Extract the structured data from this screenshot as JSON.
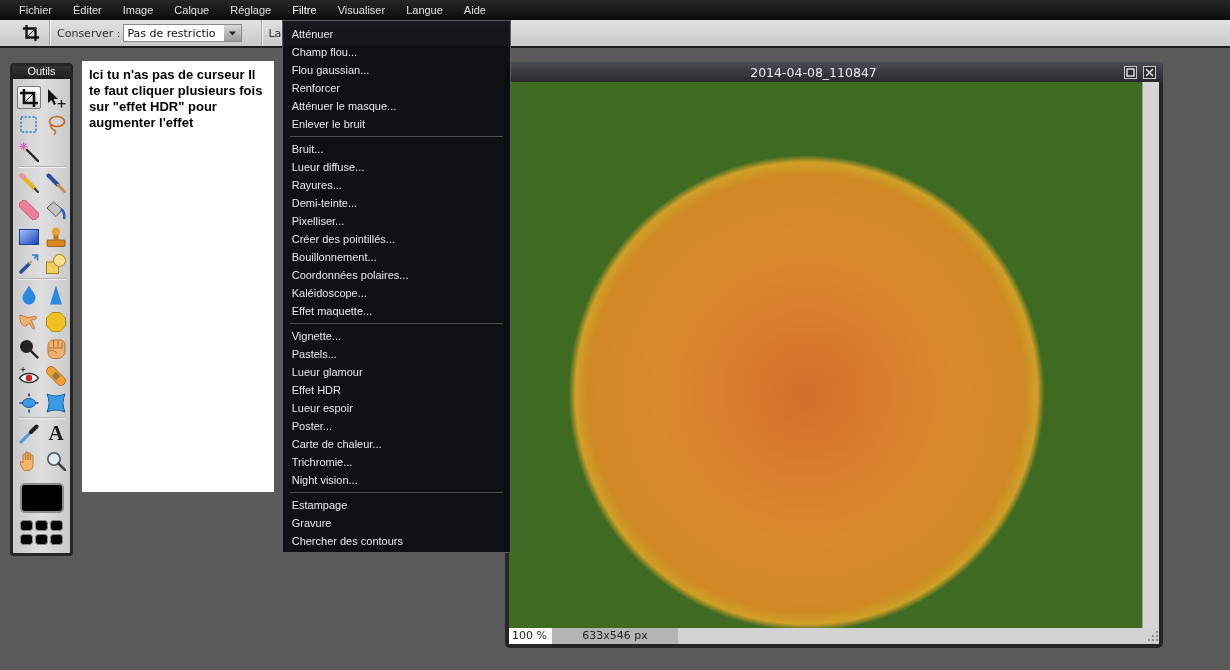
{
  "menu_bar": [
    {
      "label": "Fichier",
      "open": false
    },
    {
      "label": "Éditer",
      "open": false
    },
    {
      "label": "Image",
      "open": false
    },
    {
      "label": "Calque",
      "open": false
    },
    {
      "label": "Réglage",
      "open": false
    },
    {
      "label": "Filtre",
      "open": true,
      "groups": [
        [
          "Atténuer",
          "Champ flou...",
          "Flou gaussian...",
          "Renforcer",
          "Atténuer le masque...",
          "Enlever le bruit"
        ],
        [
          "Bruit...",
          "Lueur diffuse...",
          "Rayures...",
          "Demi-teinte...",
          "Pixelliser...",
          "Créer des pointillés...",
          "Bouillonnement...",
          "Coordonnées polaires...",
          "Kaléidoscope...",
          "Effet maquette..."
        ],
        [
          "Vignette...",
          "Pastels...",
          "Lueur glamour",
          "Effet HDR",
          "Lueur espoir",
          "Poster...",
          "Carte de chaleur...",
          "Trichromie...",
          "Night vision..."
        ],
        [
          "Estampage",
          "Gravure",
          "Chercher des contours"
        ]
      ]
    },
    {
      "label": "Visualiser",
      "open": false
    },
    {
      "label": "Langue",
      "open": false
    },
    {
      "label": "Aide",
      "open": false
    }
  ],
  "toolbar": {
    "keep_label": "Conserver :",
    "keep_value": "Pas de restrictio",
    "width_label": "La"
  },
  "tools_panel": {
    "title": "Outils",
    "groups": [
      [
        {
          "kind": "crop",
          "selected": true
        },
        {
          "kind": "move",
          "selected": false
        },
        {
          "kind": "marquee",
          "selected": false
        },
        {
          "kind": "lasso",
          "selected": false
        },
        {
          "kind": "wand",
          "selected": false
        }
      ],
      [
        {
          "kind": "pencil",
          "selected": false
        },
        {
          "kind": "brush",
          "selected": false
        },
        {
          "kind": "eraser",
          "selected": false
        },
        {
          "kind": "bucket",
          "selected": false
        },
        {
          "kind": "gradient",
          "selected": false
        },
        {
          "kind": "stamp",
          "selected": false
        },
        {
          "kind": "replace",
          "selected": false
        },
        {
          "kind": "shapes",
          "selected": false
        }
      ],
      [
        {
          "kind": "blur",
          "selected": false
        },
        {
          "kind": "sharpen",
          "selected": false
        },
        {
          "kind": "smudge",
          "selected": false
        },
        {
          "kind": "sponge",
          "selected": false
        },
        {
          "kind": "dodge",
          "selected": false
        },
        {
          "kind": "burn",
          "selected": false
        },
        {
          "kind": "redeye",
          "selected": false
        },
        {
          "kind": "heal",
          "selected": false
        },
        {
          "kind": "bloat",
          "selected": false
        },
        {
          "kind": "pinch",
          "selected": false
        }
      ],
      [
        {
          "kind": "picker",
          "selected": false
        },
        {
          "kind": "type",
          "glyph": "A",
          "selected": false
        },
        {
          "kind": "hand",
          "selected": false
        },
        {
          "kind": "zoom",
          "selected": false
        }
      ]
    ],
    "swatch": {
      "color": "#000000"
    }
  },
  "note": "Ici tu n'as pas de curseur Il te faut cliquer plusieurs fois sur \"effet HDR\" pour augmenter l'effet",
  "image_window": {
    "title": "2014-04-08_110847",
    "zoom": "100 %",
    "size": "633x546 px"
  }
}
